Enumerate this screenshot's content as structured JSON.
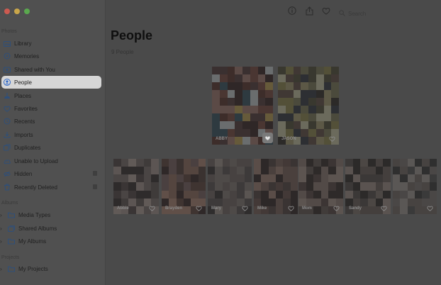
{
  "window": {
    "traffic_colors": [
      "#cc5a50",
      "#c9a64a",
      "#5aa84e"
    ]
  },
  "sidebar": {
    "photos_section": "Photos",
    "items": [
      {
        "label": "Library",
        "icon": "library-icon"
      },
      {
        "label": "Memories",
        "icon": "memories-icon"
      },
      {
        "label": "Shared with You",
        "icon": "shared-icon"
      },
      {
        "label": "People",
        "icon": "people-icon",
        "selected": true
      },
      {
        "label": "Places",
        "icon": "places-icon"
      },
      {
        "label": "Favorites",
        "icon": "heart-icon"
      },
      {
        "label": "Recents",
        "icon": "clock-icon"
      },
      {
        "label": "Imports",
        "icon": "import-icon"
      },
      {
        "label": "Duplicates",
        "icon": "duplicates-icon"
      },
      {
        "label": "Unable to Upload",
        "icon": "cloud-alert-icon"
      },
      {
        "label": "Hidden",
        "icon": "eye-slash-icon",
        "locked": true
      },
      {
        "label": "Recently Deleted",
        "icon": "trash-icon",
        "locked": true
      }
    ],
    "albums_section": "Albums",
    "albums": [
      {
        "label": "Media Types",
        "icon": "folder-icon"
      },
      {
        "label": "Shared Albums",
        "icon": "shared-albums-icon"
      },
      {
        "label": "My Albums",
        "icon": "folder-icon"
      }
    ],
    "projects_section": "Projects",
    "projects": [
      {
        "label": "My Projects",
        "icon": "folder-icon"
      }
    ]
  },
  "toolbar": {
    "icons": [
      "info-icon",
      "share-icon",
      "heart-icon"
    ],
    "search_placeholder": "Search"
  },
  "main": {
    "title": "People",
    "count": "9 People",
    "favorites": [
      {
        "name": "ABBY",
        "favorite": true
      },
      {
        "name": "JASON",
        "favorite": false
      }
    ],
    "people": [
      {
        "name": "Abbie"
      },
      {
        "name": "Brayden"
      },
      {
        "name": "Mary"
      },
      {
        "name": "Mike"
      },
      {
        "name": "Mom"
      },
      {
        "name": "Sandy"
      },
      {
        "name": ""
      }
    ]
  }
}
